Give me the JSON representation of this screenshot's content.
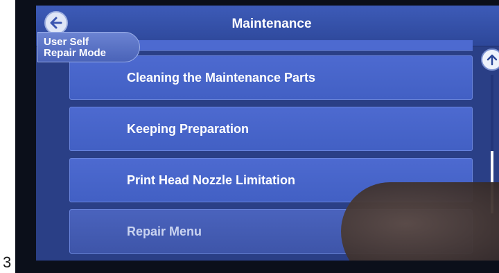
{
  "step_number": "3",
  "header": {
    "title": "Maintenance"
  },
  "mode_badge": {
    "line1": "User Self",
    "line2": "Repair Mode"
  },
  "menu": {
    "items": [
      {
        "label": "Cleaning the Maintenance Parts",
        "enabled": true
      },
      {
        "label": "Keeping Preparation",
        "enabled": true
      },
      {
        "label": "Print Head Nozzle Limitation",
        "enabled": true
      },
      {
        "label": "Repair Menu",
        "enabled": false
      }
    ]
  },
  "icons": {
    "back": "arrow-left-icon",
    "scroll_up": "arrow-up-icon"
  },
  "colors": {
    "screen_bg": "#2a3f86",
    "menu_item": "#4d6ad0",
    "badge": "#5b74c6"
  }
}
